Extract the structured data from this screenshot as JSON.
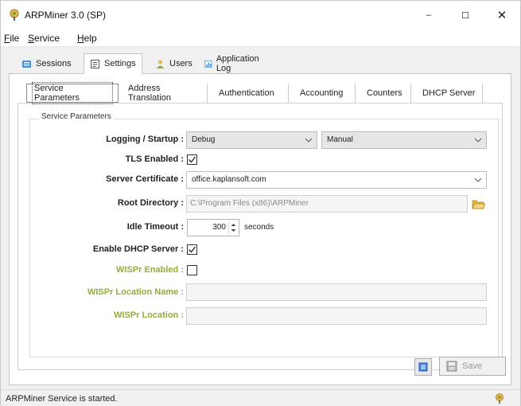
{
  "window": {
    "title": "ARPMiner 3.0 (SP)",
    "min_glyph": "–",
    "max_glyph": "☐",
    "close_glyph": "✕"
  },
  "menu": {
    "file_u": "F",
    "file_rest": "ile",
    "service_u": "S",
    "service_rest": "ervice",
    "help_u": "H",
    "help_rest": "elp"
  },
  "main_tabs": [
    {
      "label": "Sessions",
      "icon": "sessions-icon"
    },
    {
      "label": "Settings",
      "icon": "settings-icon",
      "active": true
    },
    {
      "label": "Users",
      "icon": "users-icon"
    },
    {
      "label": "Application Log",
      "icon": "log-icon"
    }
  ],
  "sub_tabs": [
    {
      "label": "Service Parameters",
      "active": true
    },
    {
      "label": "Address Translation"
    },
    {
      "label": "Authentication"
    },
    {
      "label": "Accounting"
    },
    {
      "label": "Counters"
    },
    {
      "label": "DHCP Server"
    }
  ],
  "group": {
    "title": "Service Parameters"
  },
  "form": {
    "logging_label": "Logging / Startup :",
    "logging_value": "Debug",
    "startup_value": "Manual",
    "tls_label": "TLS Enabled :",
    "tls_checked": true,
    "cert_label": "Server Certificate :",
    "cert_value": "office.kaplansoft.com",
    "root_label": "Root Directory :",
    "root_value": "C:\\Program Files (x86)\\ARPMiner",
    "idle_label": "Idle Timeout :",
    "idle_value": "300",
    "idle_unit": "seconds",
    "dhcp_label": "Enable DHCP Server :",
    "dhcp_checked": true,
    "wispr_enabled_label": "WISPr Enabled :",
    "wispr_enabled_checked": false,
    "wispr_location_name_label": "WISPr Location Name :",
    "wispr_location_name_value": "",
    "wispr_location_label": "WISPr Location :",
    "wispr_location_value": ""
  },
  "buttons": {
    "save_label": "Save"
  },
  "status": {
    "text": "ARPMiner Service is started."
  },
  "colors": {
    "accent_green": "#8fae3b",
    "folder_yellow": "#e8b84a"
  }
}
